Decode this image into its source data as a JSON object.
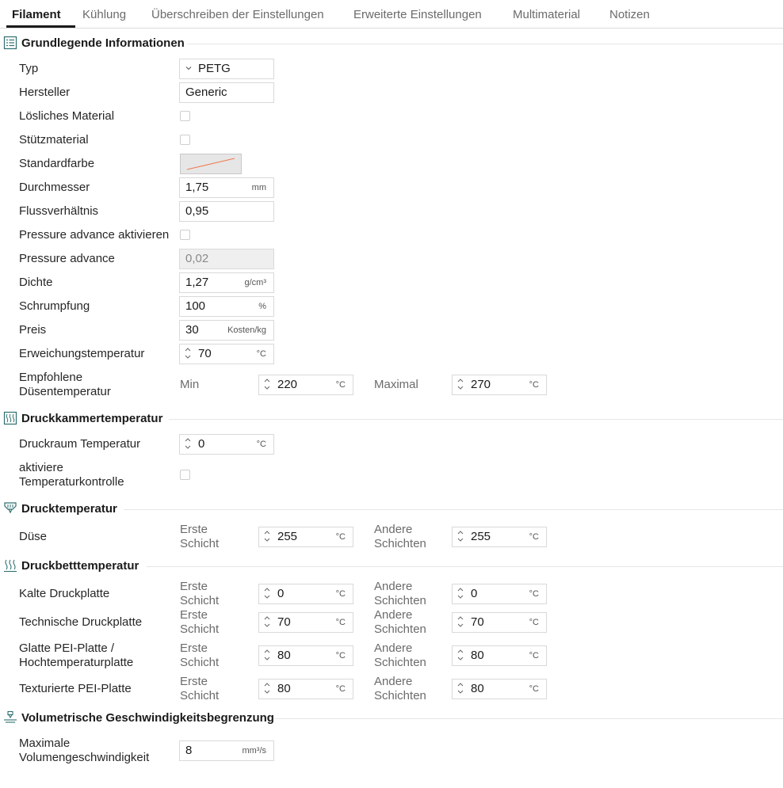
{
  "tabs": [
    {
      "label": "Filament",
      "active": true
    },
    {
      "label": "Kühlung",
      "active": false
    },
    {
      "label": "Überschreiben der Einstellungen",
      "active": false
    },
    {
      "label": "Erweiterte Einstellungen",
      "active": false
    },
    {
      "label": "Multimaterial",
      "active": false
    },
    {
      "label": "Notizen",
      "active": false
    }
  ],
  "basic": {
    "title": "Grundlegende Informationen",
    "icon": "list-icon",
    "type": {
      "label": "Typ",
      "value": "PETG"
    },
    "vendor": {
      "label": "Hersteller",
      "value": "Generic"
    },
    "soluble": {
      "label": "Lösliches Material",
      "checked": false
    },
    "support": {
      "label": "Stützmaterial",
      "checked": false
    },
    "color": {
      "label": "Standardfarbe",
      "stroke": "#f07a50"
    },
    "diameter": {
      "label": "Durchmesser",
      "value": "1,75",
      "unit": "mm"
    },
    "flow": {
      "label": "Flussverhältnis",
      "value": "0,95"
    },
    "pa_enable": {
      "label": "Pressure advance aktivieren",
      "checked": false
    },
    "pa": {
      "label": "Pressure advance",
      "value": "0,02"
    },
    "density": {
      "label": "Dichte",
      "value": "1,27",
      "unit": "g/cm³"
    },
    "shrink": {
      "label": "Schrumpfung",
      "value": "100",
      "unit": "%"
    },
    "price": {
      "label": "Preis",
      "value": "30",
      "unit": "Kosten/kg"
    },
    "soften": {
      "label": "Erweichungstemperatur",
      "value": "70",
      "unit": "°C"
    },
    "nozzle_range": {
      "label_line1": "Empfohlene",
      "label_line2": "Düsentemperatur",
      "min_label": "Min",
      "min_value": "220",
      "max_label": "Maximal",
      "max_value": "270",
      "unit": "°C"
    }
  },
  "chamber": {
    "title": "Druckkammertemperatur",
    "icon": "chamber-icon",
    "temp": {
      "label": "Druckraum Temperatur",
      "value": "0",
      "unit": "°C"
    },
    "control": {
      "label_line1": "aktiviere",
      "label_line2": "Temperaturkontrolle",
      "checked": false
    }
  },
  "print_temp": {
    "title": "Drucktemperatur",
    "icon": "nozzle-icon",
    "nozzle": {
      "label": "Düse",
      "first_line1": "Erste",
      "first_line2": "Schicht",
      "first_value": "255",
      "other_line1": "Andere",
      "other_line2": "Schichten",
      "other_value": "255",
      "unit": "°C"
    }
  },
  "bed_temp": {
    "title": "Druckbetttemperatur",
    "icon": "heat-icon",
    "first_line1": "Erste",
    "first_line2": "Schicht",
    "other_line1": "Andere",
    "other_line2": "Schichten",
    "unit": "°C",
    "plates": [
      {
        "label_line1": "Kalte Druckplatte",
        "label_line2": "",
        "first": "0",
        "other": "0"
      },
      {
        "label_line1": "Technische Druckplatte",
        "label_line2": "",
        "first": "70",
        "other": "70"
      },
      {
        "label_line1": "Glatte PEI-Platte /",
        "label_line2": "Hochtemperaturplatte",
        "first": "80",
        "other": "80"
      },
      {
        "label_line1": "Texturierte PEI-Platte",
        "label_line2": "",
        "first": "80",
        "other": "80"
      }
    ]
  },
  "volumetric": {
    "title": "Volumetrische Geschwindigkeitsbegrenzung",
    "icon": "speed-limit-icon",
    "max": {
      "label_line1": "Maximale",
      "label_line2": "Volumengeschwindigkeit",
      "value": "8",
      "unit": "mm³/s"
    }
  }
}
